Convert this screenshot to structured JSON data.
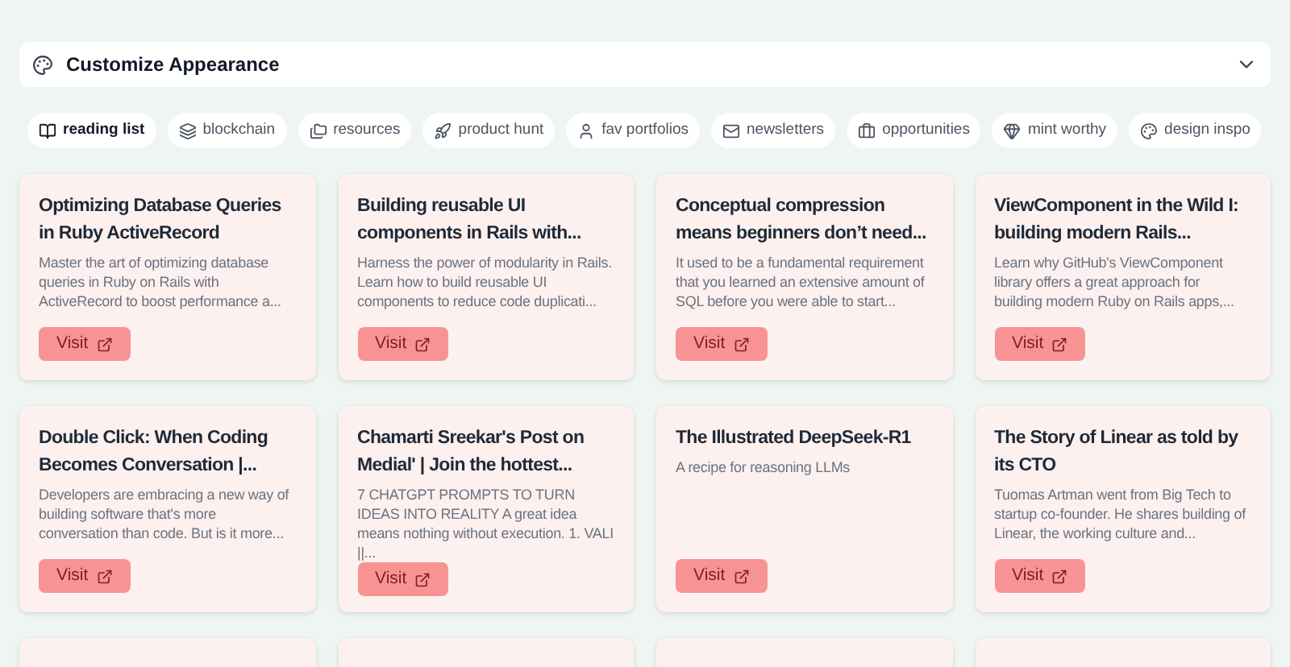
{
  "appearance_panel": {
    "title": "Customize Appearance",
    "expanded": false
  },
  "tabs": [
    {
      "label": "reading list",
      "selected": true
    },
    {
      "label": "blockchain",
      "selected": false
    },
    {
      "label": "resources",
      "selected": false
    },
    {
      "label": "product hunt",
      "selected": false
    },
    {
      "label": "fav portfolios",
      "selected": false
    },
    {
      "label": "newsletters",
      "selected": false
    },
    {
      "label": "opportunities",
      "selected": false
    },
    {
      "label": "mint worthy",
      "selected": false
    },
    {
      "label": "design inspo",
      "selected": false
    }
  ],
  "cards": [
    {
      "kind": "link",
      "title": "Optimizing Database Queries in Ruby ActiveRecord",
      "description": "Master the art of optimizing database queries in Ruby on Rails with ActiveRecord to boost performance a...",
      "button": "Visit"
    },
    {
      "kind": "link",
      "title": "Building reusable UI components in Rails with...",
      "description": "Harness the power of modularity in Rails. Learn how to build reusable UI components to reduce code duplicati...",
      "button": "Visit"
    },
    {
      "kind": "link",
      "title": "Conceptual compression means beginners don’t need...",
      "description": "It used to be a fundamental requirement that you learned an extensive amount of SQL before you were able to start...",
      "button": "Visit"
    },
    {
      "kind": "link",
      "title": "ViewComponent in the Wild I: building modern Rails...",
      "description": "Learn why GitHub's ViewComponent library offers a great approach for building modern Ruby on Rails apps,...",
      "button": "Visit"
    },
    {
      "kind": "link",
      "title": "Double Click: When Coding Becomes Conversation |...",
      "description": "Developers are embracing a new way of building software that's more conversation than code. But is it more...",
      "button": "Visit"
    },
    {
      "kind": "link",
      "title": "Chamarti Sreekar's Post on Medial' | Join the hottest...",
      "description": "7 CHATGPT PROMPTS TO TURN IDEAS INTO REALITY A great idea means nothing without execution. 1. VALI ||...",
      "button": "Visit"
    },
    {
      "kind": "link",
      "title": "The Illustrated DeepSeek-R1",
      "description": "A recipe for reasoning LLMs",
      "button": "Visit"
    },
    {
      "kind": "link",
      "title": "The Story of Linear as told by its CTO",
      "description": "Tuomas Artman went from Big Tech to startup co-founder. He shares building of Linear, the working culture and...",
      "button": "Visit"
    },
    {
      "kind": "clipped"
    },
    {
      "kind": "clipped"
    },
    {
      "kind": "clipped"
    },
    {
      "kind": "clipped"
    }
  ]
}
